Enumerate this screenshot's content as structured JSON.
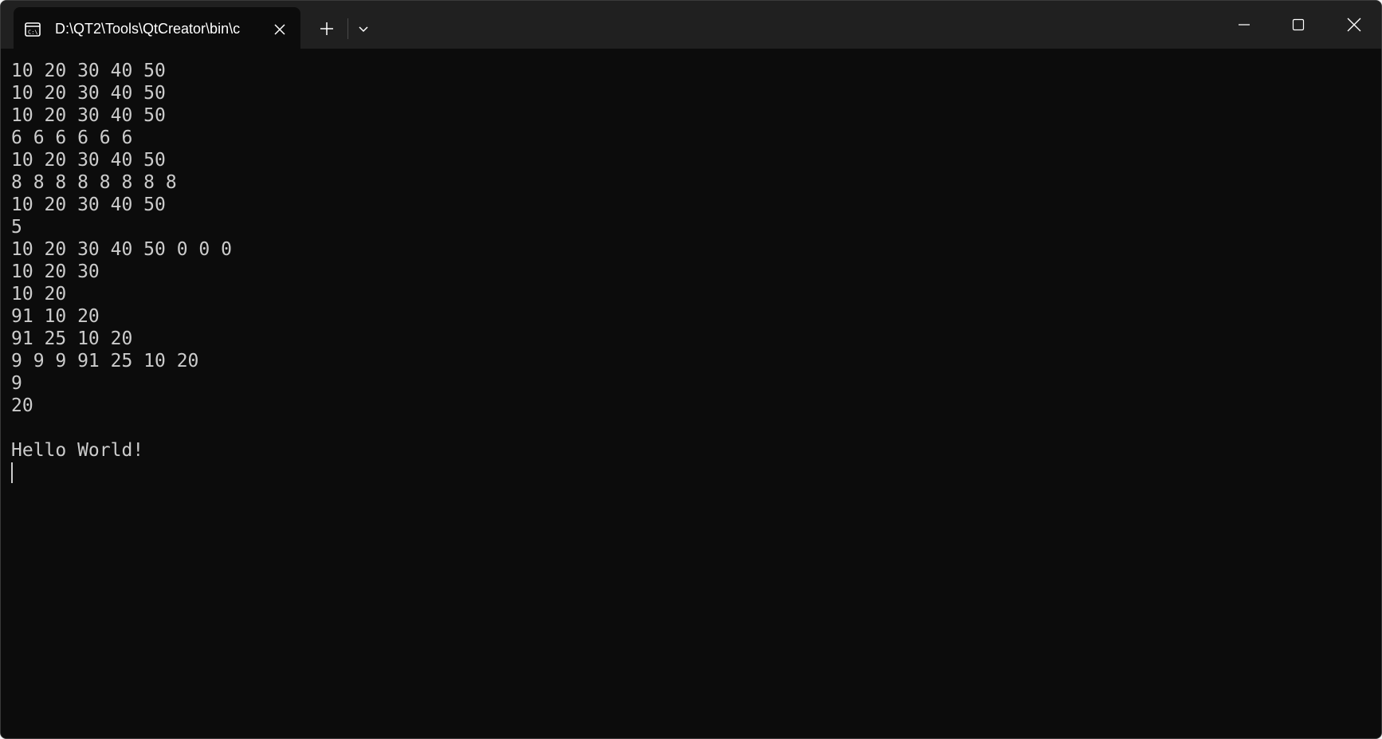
{
  "window": {
    "tab_title": "D:\\QT2\\Tools\\QtCreator\\bin\\c"
  },
  "terminal": {
    "lines": [
      "10 20 30 40 50",
      "10 20 30 40 50",
      "10 20 30 40 50",
      "6 6 6 6 6 6",
      "10 20 30 40 50",
      "8 8 8 8 8 8 8 8",
      "10 20 30 40 50",
      "5",
      "10 20 30 40 50 0 0 0",
      "10 20 30",
      "10 20",
      "91 10 20",
      "91 25 10 20",
      "9 9 9 91 25 10 20",
      "9",
      "20",
      "",
      "Hello World!"
    ]
  },
  "icons": {
    "tab": "console-icon",
    "close_tab": "close-icon",
    "new_tab": "plus-icon",
    "dropdown": "chevron-down-icon",
    "minimize": "minimize-icon",
    "maximize": "maximize-icon",
    "close_window": "close-icon"
  },
  "colors": {
    "titlebar": "#202020",
    "terminal_bg": "#0c0c0c",
    "terminal_fg": "#cccccc"
  }
}
